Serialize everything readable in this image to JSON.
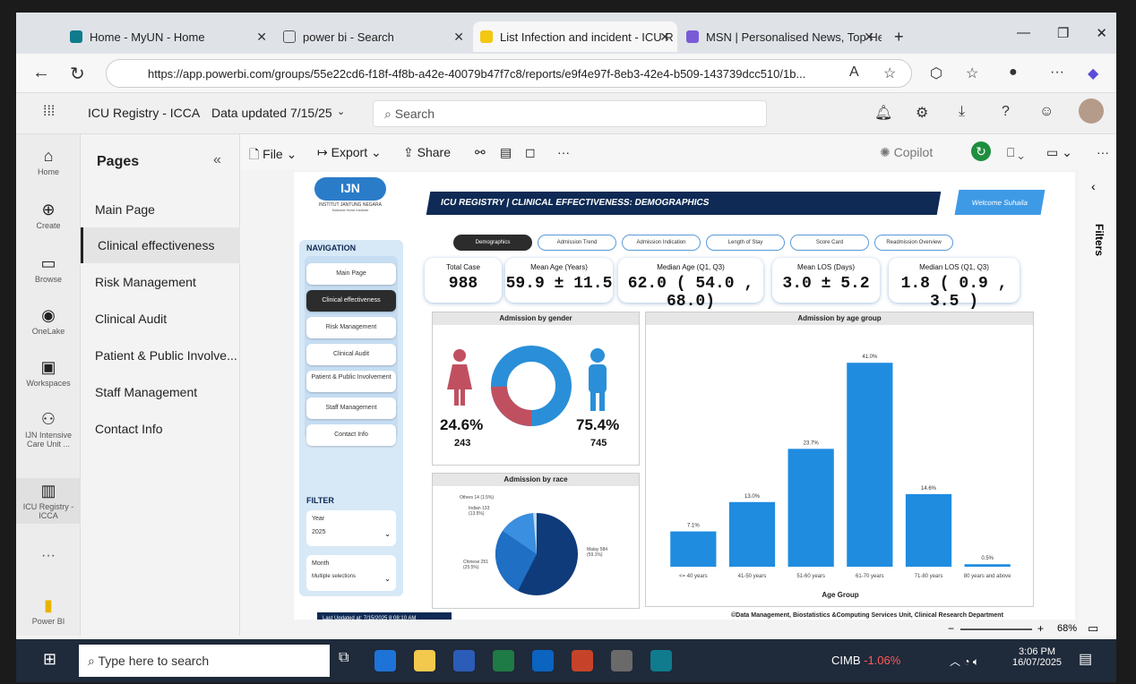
{
  "browser": {
    "tabs": [
      {
        "label": "Home - MyUN - Home"
      },
      {
        "label": "power bi - Search"
      },
      {
        "label": "List Infection and incident - ICU R"
      },
      {
        "label": "MSN | Personalised News, Top He"
      }
    ],
    "url": "https://app.powerbi.com/groups/55e22cd6-f18f-4f8b-a42e-40079b47f7c8/reports/e9f4e97f-8eb3-42e4-b509-143739dcc510/1b..."
  },
  "pbi": {
    "workspace": "ICU Registry - ICCA",
    "data_updated": "Data updated 7/15/25",
    "search_placeholder": "Search",
    "copilot": "Copilot",
    "filters": "Filters"
  },
  "rail": [
    {
      "label": "Home"
    },
    {
      "label": "Create"
    },
    {
      "label": "Browse"
    },
    {
      "label": "OneLake"
    },
    {
      "label": "Workspaces"
    },
    {
      "label": "IJN Intensive Care Unit ..."
    },
    {
      "label": "ICU Registry - ICCA"
    },
    {
      "label": "Power BI"
    }
  ],
  "pages": {
    "title": "Pages",
    "items": [
      "Main Page",
      "Clinical effectiveness",
      "Risk Management",
      "Clinical Audit",
      "Patient & Public Involve...",
      "Staff Management",
      "Contact Info"
    ]
  },
  "toolbar": {
    "file": "File",
    "export": "Export",
    "share": "Share"
  },
  "report": {
    "logo_title": "IJN",
    "logo_sub": "INSTITUT JANTUNG NEGARA",
    "logo_sub2": "National Heart Institute",
    "banner": "ICU REGISTRY | CLINICAL EFFECTIVENESS: DEMOGRAPHICS",
    "welcome": "Welcome Suhaila",
    "tabs": [
      "Demographics",
      "Admission Trend",
      "Admission Indication",
      "Length of Stay",
      "Score Card",
      "Readmission Overview"
    ],
    "nav_title": "NAVIGATION",
    "nav": [
      "Main Page",
      "Clinical effectiveness",
      "Risk Management",
      "Clinical Audit",
      "Patient & Public Involvement",
      "Staff Management",
      "Contact Info"
    ],
    "filter_title": "FILTER",
    "year_label": "Year",
    "year_value": "2025",
    "month_label": "Month",
    "month_value": "Multiple selections",
    "last_updated": "Last Updated at:  7/15/2025 8:08:10 AM",
    "footer": "©Data Management, Biostatistics &Computing Services Unit, Clinical Research Department",
    "kpis": [
      {
        "label": "Total Case",
        "value": "988"
      },
      {
        "label": "Mean Age (Years)",
        "value": "59.9 ± 11.5"
      },
      {
        "label": "Median Age (Q1, Q3)",
        "value": "62.0 ( 54.0 , 68.0)"
      },
      {
        "label": "Mean LOS (Days)",
        "value": "3.0 ± 5.2"
      },
      {
        "label": "Median LOS (Q1, Q3)",
        "value": "1.8 ( 0.9 , 3.5 )"
      }
    ],
    "gender": {
      "title": "Admission by gender",
      "female_pct": "24.6%",
      "female_n": "243",
      "male_pct": "75.4%",
      "male_n": "745",
      "female_frac": 0.246,
      "female_color": "#c05060",
      "male_color": "#2a8fd8"
    },
    "race": {
      "title": "Admission by race",
      "labels": [
        "Others 14 (1.5%)",
        "Indian 133 (13.5%)",
        "Chinese 251 (25.5%)",
        "Malay 584 (59.1%)"
      ]
    }
  },
  "chart_data": {
    "type": "bar",
    "title": "Admission by age group",
    "xlabel": "Age Group",
    "categories": [
      "<= 40 years",
      "41-50 years",
      "51-60 years",
      "61-70 years",
      "71-80 years",
      "80 years and above"
    ],
    "values": [
      7.1,
      13.0,
      23.7,
      41.0,
      14.6,
      0.5
    ],
    "value_labels": [
      "7.1%",
      "13.0%",
      "23.7%",
      "41.0%",
      "14.6%",
      "0.5%"
    ],
    "ylim": [
      0,
      45
    ],
    "color": "#1f8ce0"
  },
  "status": {
    "zoom": "68%"
  },
  "taskbar": {
    "search": "Type here to search",
    "stock": "CIMB",
    "stock_change": "-1.06%",
    "time": "3:06 PM",
    "date": "16/07/2025"
  }
}
